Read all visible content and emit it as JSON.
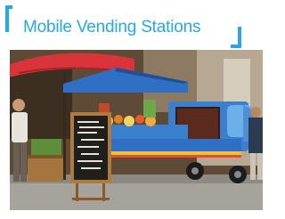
{
  "header": {
    "title": "Mobile Vending Stations"
  },
  "colors": {
    "accent": "#29a7e0",
    "vehicle": "#3b7fcf",
    "umbrella": "#d9343a"
  },
  "photo": {
    "subject": "street-vending-tricycle-truck-image"
  }
}
